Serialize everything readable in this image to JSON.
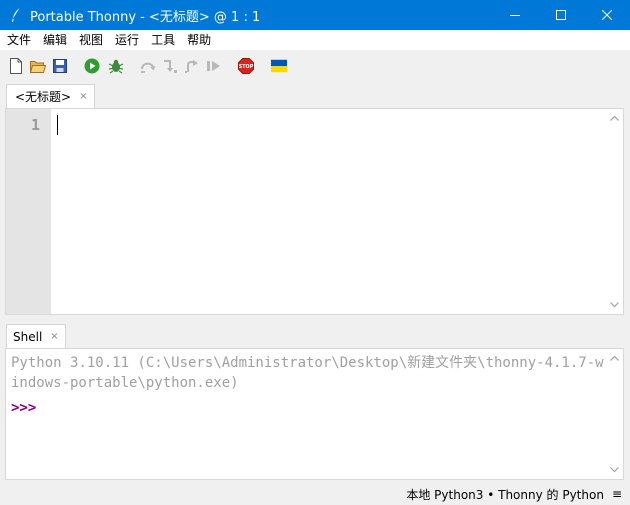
{
  "window": {
    "title": "Portable Thonny  -  <无标题>  @  1 : 1"
  },
  "menu": [
    "文件",
    "编辑",
    "视图",
    "运行",
    "工具",
    "帮助"
  ],
  "toolbar": {
    "icons": [
      "new-file-icon",
      "open-file-icon",
      "save-icon",
      "run-icon",
      "debug-icon",
      "step-over-icon",
      "step-into-icon",
      "step-out-icon",
      "resume-icon",
      "stop-icon",
      "ukraine-flag-icon"
    ],
    "colors": {
      "run": "#2e9e2e",
      "stop": "#d9261c",
      "flag_blue": "#0057b7",
      "flag_yellow": "#ffd700"
    }
  },
  "editor": {
    "tab_label": "<无标题>",
    "tab_close": "×",
    "line_number": "1"
  },
  "shell": {
    "tab_label": "Shell",
    "tab_close": "×",
    "output": "Python 3.10.11 (C:\\Users\\Administrator\\Desktop\\新建文件夹\\thonny-4.1.7-windows-portable\\python.exe)",
    "prompt": ">>>"
  },
  "statusbar": {
    "interpreter": "本地 Python3  •  Thonny 的 Python",
    "menu_icon": "≡"
  },
  "colors": {
    "titlebar": "#0078d7",
    "prompt": "#8b008b",
    "gutter": "#e4e4e4"
  }
}
